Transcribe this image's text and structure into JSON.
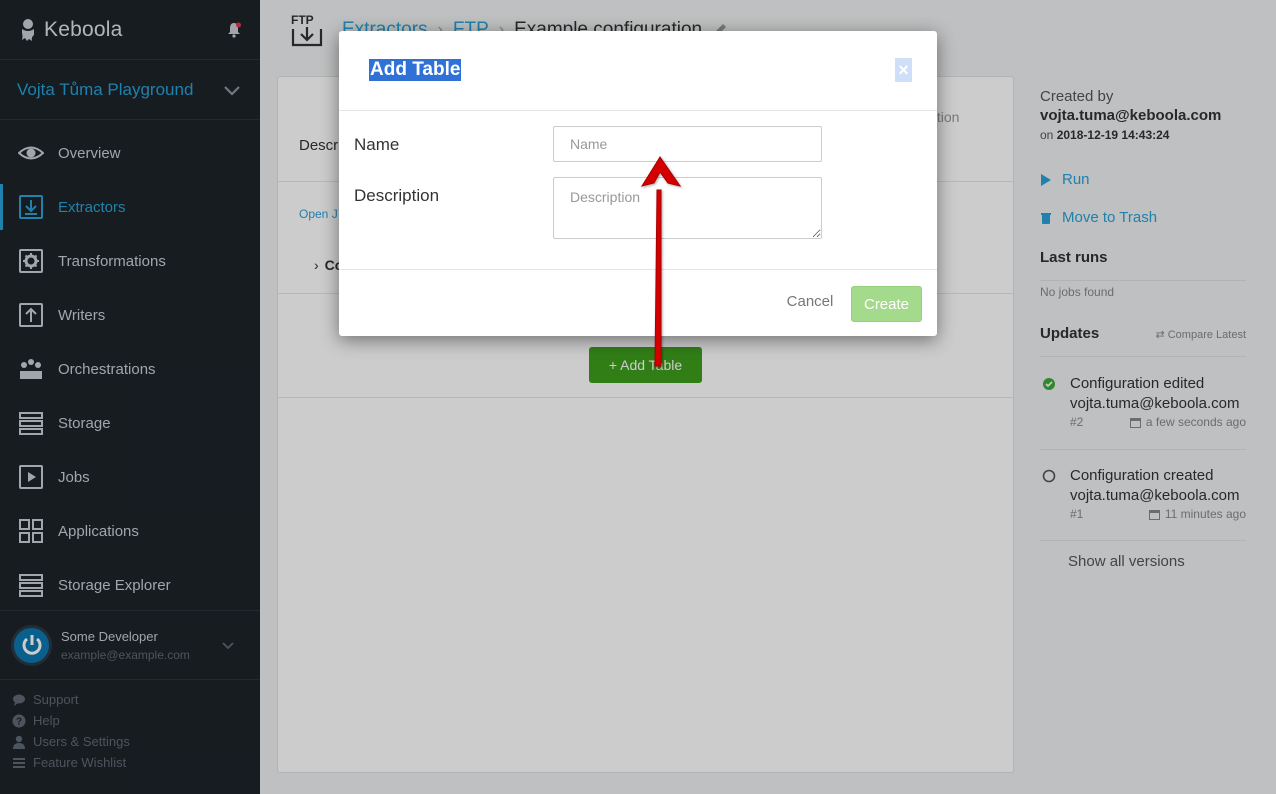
{
  "sidebar": {
    "logo": "Keboola",
    "project": "Vojta Tůma Playground",
    "nav": [
      {
        "label": "Overview",
        "icon": "eye-icon"
      },
      {
        "label": "Extractors",
        "icon": "extractor-icon",
        "active": true
      },
      {
        "label": "Transformations",
        "icon": "gear-icon"
      },
      {
        "label": "Writers",
        "icon": "writer-icon"
      },
      {
        "label": "Orchestrations",
        "icon": "orchestration-icon"
      },
      {
        "label": "Storage",
        "icon": "storage-icon"
      },
      {
        "label": "Jobs",
        "icon": "play-icon"
      },
      {
        "label": "Applications",
        "icon": "apps-icon"
      },
      {
        "label": "Storage Explorer",
        "icon": "storage-explorer-icon"
      }
    ],
    "user": {
      "name": "Some Developer",
      "email": "example@example.com"
    },
    "links": [
      "Support",
      "Help",
      "Users & Settings",
      "Feature Wishlist"
    ]
  },
  "breadcrumb": {
    "items": [
      "Extractors",
      "FTP"
    ],
    "current": "Example configuration"
  },
  "panel": {
    "description_label": "Descr",
    "description_right": "iption",
    "open_link": "Open J",
    "collapsed_label": "Co",
    "add_table_button": "+ Add Table"
  },
  "info": {
    "created_by_label": "Created by",
    "creator": "vojta.tuma@keboola.com",
    "on_label": "on",
    "created_at": "2018-12-19 14:43:24",
    "run": "Run",
    "trash": "Move to Trash",
    "last_runs": "Last runs",
    "no_jobs": "No jobs found",
    "updates": "Updates",
    "compare_latest": "Compare Latest",
    "versions": [
      {
        "title": "Configuration edited",
        "email": "vojta.tuma@keboola.com",
        "num": "#2",
        "time": "a few seconds ago",
        "status_color": "#3ea939"
      },
      {
        "title": "Configuration created",
        "email": "vojta.tuma@keboola.com",
        "num": "#1",
        "time": "11 minutes ago",
        "status_color": "#555555"
      }
    ],
    "show_all": "Show all versions"
  },
  "modal": {
    "title": "Add Table",
    "close": "×",
    "name_label": "Name",
    "name_placeholder": "Name",
    "name_value": "",
    "description_label": "Description",
    "description_placeholder": "Description",
    "cancel": "Cancel",
    "create": "Create"
  },
  "colors": {
    "accent": "#27a2d7",
    "sidebar": "#1c2329",
    "success": "#3e9e1d",
    "arrow": "#d40000"
  }
}
